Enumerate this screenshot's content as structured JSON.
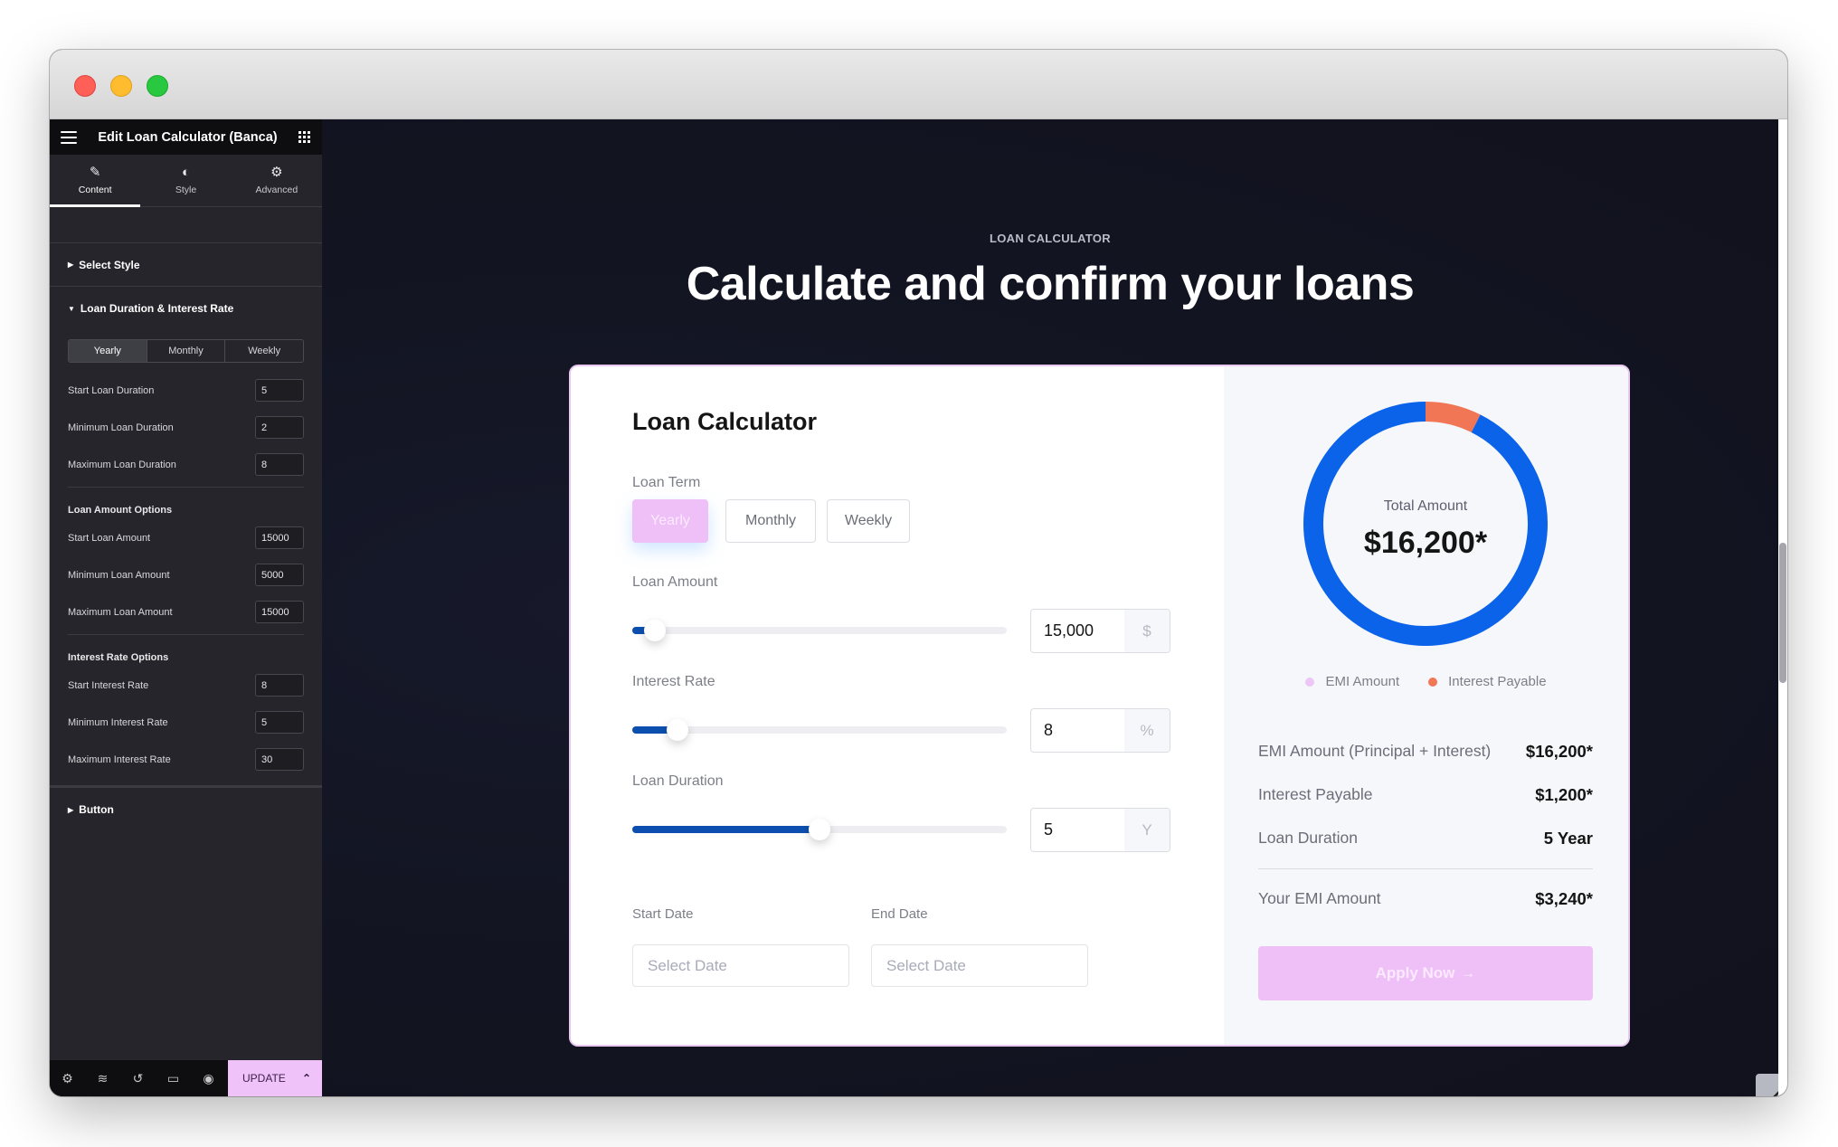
{
  "window": {
    "traffic_lights": [
      "close",
      "minimize",
      "maximize"
    ]
  },
  "editor": {
    "title": "Edit Loan Calculator (Banca)",
    "menu_icon": "hamburger-icon",
    "apps_icon": "grid-icon",
    "tabs": [
      {
        "label": "Content",
        "icon": "pencil-icon",
        "active": true
      },
      {
        "label": "Style",
        "icon": "half-circle-icon",
        "active": false
      },
      {
        "label": "Advanced",
        "icon": "gear-icon",
        "active": false
      }
    ],
    "sections": {
      "select_style": "Select Style",
      "loan_duration": "Loan Duration & Interest Rate",
      "button": "Button"
    },
    "period_segments": [
      {
        "label": "Yearly",
        "active": true
      },
      {
        "label": "Monthly",
        "active": false
      },
      {
        "label": "Weekly",
        "active": false
      }
    ],
    "duration_fields": [
      {
        "label": "Start Loan Duration",
        "value": "5"
      },
      {
        "label": "Minimum Loan Duration",
        "value": "2"
      },
      {
        "label": "Maximum Loan Duration",
        "value": "8"
      }
    ],
    "loan_amount_options_title": "Loan Amount Options",
    "amount_fields": [
      {
        "label": "Start Loan Amount",
        "value": "15000"
      },
      {
        "label": "Minimum Loan Amount",
        "value": "5000"
      },
      {
        "label": "Maximum Loan Amount",
        "value": "15000"
      }
    ],
    "interest_rate_options_title": "Interest Rate Options",
    "interest_fields": [
      {
        "label": "Start Interest Rate",
        "value": "8"
      },
      {
        "label": "Minimum Interest Rate",
        "value": "5"
      },
      {
        "label": "Maximum Interest Rate",
        "value": "30"
      }
    ],
    "footer": {
      "icons": [
        "settings-icon",
        "layers-icon",
        "history-icon",
        "responsive-icon",
        "preview-eye-icon"
      ],
      "update_label": "UPDATE"
    }
  },
  "page": {
    "eyebrow": "LOAN CALCULATOR",
    "headline": "Calculate and confirm your loans",
    "calculator": {
      "title": "Loan Calculator",
      "loan_term_label": "Loan Term",
      "term_buttons": [
        {
          "label": "Yearly",
          "active": true
        },
        {
          "label": "Monthly",
          "active": false
        },
        {
          "label": "Weekly",
          "active": false
        }
      ],
      "loan_amount": {
        "label": "Loan Amount",
        "value": "15,000",
        "unit": "$",
        "min": 5000,
        "max": 15000,
        "slider_fraction": 0.06
      },
      "interest_rate": {
        "label": "Interest Rate",
        "value": "8",
        "unit": "%",
        "min": 5,
        "max": 30,
        "slider_fraction": 0.12
      },
      "loan_duration": {
        "label": "Loan Duration",
        "value": "5",
        "unit": "Y",
        "min": 2,
        "max": 8,
        "slider_fraction": 0.5
      },
      "start_date": {
        "label": "Start Date",
        "placeholder": "Select Date"
      },
      "end_date": {
        "label": "End Date",
        "placeholder": "Select Date"
      }
    },
    "summary": {
      "total_label": "Total Amount",
      "total_value": "$16,200*",
      "legend": [
        {
          "label": "EMI Amount",
          "color": "#ecc6f5"
        },
        {
          "label": "Interest Payable",
          "color": "#f07656"
        }
      ],
      "rows": [
        {
          "label": "EMI Amount (Principal + Interest)",
          "value": "$16,200*"
        },
        {
          "label": "Interest Payable",
          "value": "$1,200*"
        },
        {
          "label": "Loan Duration",
          "value": "5 Year"
        }
      ],
      "your_emi": {
        "label": "Your EMI Amount",
        "value": "$3,240*"
      },
      "apply_label": "Apply Now",
      "apply_arrow": "→"
    }
  },
  "chart_data": {
    "type": "pie",
    "title": "Total Amount",
    "center_label": "$16,200*",
    "categories": [
      "Principal (EMI Amount)",
      "Interest Payable"
    ],
    "values": [
      15000,
      1200
    ],
    "colors": [
      "#0a63e8",
      "#f07656"
    ],
    "donut": true,
    "legend": "bottom"
  },
  "colors": {
    "accent_pink": "#efc0f8",
    "slider_blue": "#0d4fae",
    "donut_blue": "#0a63e8",
    "interest_orange": "#f07656",
    "canvas_bg": "#121421"
  },
  "scroll_top_icon": "chevron-up-icon"
}
